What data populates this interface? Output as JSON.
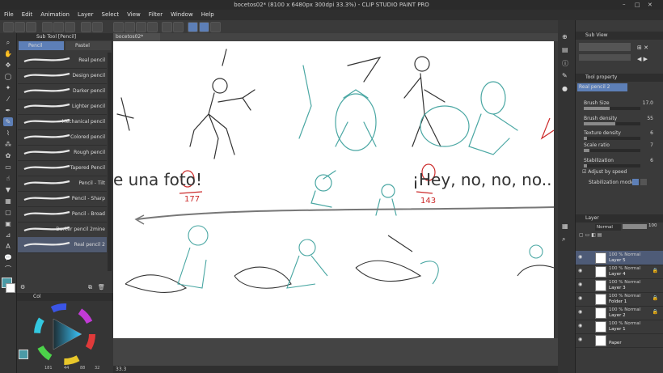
{
  "window": {
    "title": "bocetos02* (8100 x 6480px 300dpi 33.3%)  - CLIP STUDIO PAINT PRO"
  },
  "menu": [
    "File",
    "Edit",
    "Animation",
    "Layer",
    "Select",
    "View",
    "Filter",
    "Window",
    "Help"
  ],
  "subtool": {
    "header": "Sub Tool [Pencil]",
    "tabs": [
      "Pencil",
      "Pastel"
    ],
    "brushes": [
      "Real pencil",
      "Design pencil",
      "Darker pencil",
      "Lighter pencil",
      "Mechanical pencil",
      "Colored pencil",
      "Rough pencil",
      "Tapered Pencil",
      "Pencil - Tilt",
      "Pencil - Sharp",
      "Pencil - Broad",
      "Darker pencil 2mine",
      "Real pencil 2"
    ],
    "selected_index": 12
  },
  "color": {
    "tab": "Col",
    "values": [
      "181",
      "44",
      "88",
      "32"
    ]
  },
  "document": {
    "tab": "bocetos02*",
    "zoom": "33.3"
  },
  "canvas_text": {
    "left": "e una foto!",
    "right": "¡Hey, no, no, no..",
    "num1": "177",
    "num2": "143"
  },
  "subview": {
    "title": "Sub View"
  },
  "toolprop": {
    "title": "Tool property",
    "brush_name": "Real pencil 2",
    "brush_size": {
      "label": "Brush Size",
      "value": "17.0",
      "fill": 0.45
    },
    "brush_density": {
      "label": "Brush density",
      "value": "55",
      "fill": 0.55
    },
    "texture_density": {
      "label": "Texture density",
      "value": "6",
      "fill": 0.06
    },
    "scale_ratio": {
      "label": "Scale ratio",
      "value": "7",
      "fill": 0.1
    },
    "stabilization": {
      "label": "Stabilization",
      "value": "6",
      "fill": 0.06
    },
    "adjust_speed": "Adjust by speed",
    "stab_mode": "Stabilization mode"
  },
  "layers": {
    "title": "Layer",
    "blend": "Normal",
    "opacity": "100",
    "rows": [
      {
        "mode": "100 % Normal",
        "name": "Layer 5",
        "selected": true,
        "locked": false
      },
      {
        "mode": "100 % Normal",
        "name": "Layer 4",
        "selected": false,
        "locked": true
      },
      {
        "mode": "100 % Normal",
        "name": "Layer 3",
        "selected": false,
        "locked": false
      },
      {
        "mode": "100 % Normal",
        "name": "Folder 1",
        "selected": false,
        "locked": true
      },
      {
        "mode": "100 % Normal",
        "name": "Layer 2",
        "selected": false,
        "locked": true
      },
      {
        "mode": "100 % Normal",
        "name": "Layer 1",
        "selected": false,
        "locked": false
      },
      {
        "mode": "",
        "name": "Paper",
        "selected": false,
        "locked": false
      }
    ]
  },
  "colors": {
    "accent": "#5d7fb7",
    "sketch_teal": "#4aa7a3",
    "sketch_red": "#cc2b2b",
    "main_color": "#4b9aa6"
  }
}
